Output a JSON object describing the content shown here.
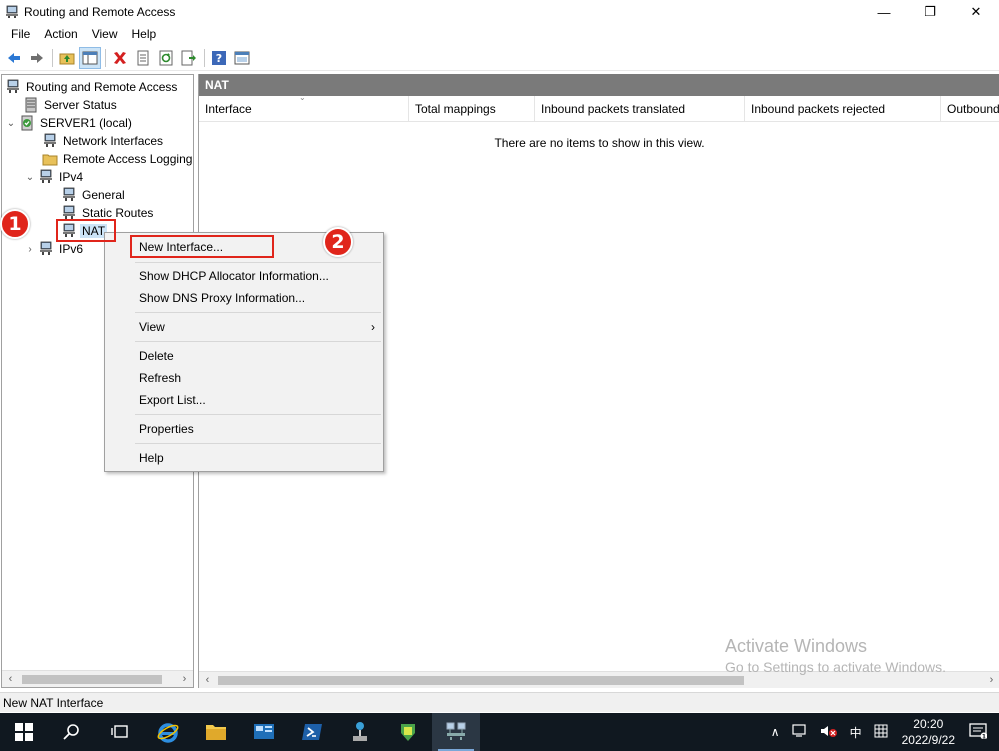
{
  "window": {
    "title": "Routing and Remote Access",
    "minimize_glyph": "—",
    "maximize_glyph": "❐",
    "close_glyph": "✕"
  },
  "menu": [
    "File",
    "Action",
    "View",
    "Help"
  ],
  "tree": {
    "root": "Routing and Remote Access",
    "server_status": "Server Status",
    "server": "SERVER1 (local)",
    "network_interfaces": "Network Interfaces",
    "remote_access_logging": "Remote Access Logging",
    "ipv4": "IPv4",
    "general": "General",
    "static_routes": "Static Routes",
    "nat": "NAT",
    "ipv6": "IPv6"
  },
  "result": {
    "header": "NAT",
    "columns": [
      "Interface",
      "Total mappings",
      "Inbound packets translated",
      "Inbound packets rejected",
      "Outbound"
    ],
    "empty_message": "There are no items to show in this view."
  },
  "context_menu": {
    "new_interface": "New Interface...",
    "show_dhcp": "Show DHCP Allocator Information...",
    "show_dns": "Show DNS Proxy Information...",
    "view": "View",
    "delete": "Delete",
    "refresh": "Refresh",
    "export_list": "Export List...",
    "properties": "Properties",
    "help": "Help"
  },
  "annotations": {
    "step1": "1",
    "step2": "2"
  },
  "watermark": {
    "line1": "Activate Windows",
    "line2": "Go to Settings to activate Windows."
  },
  "status": "New NAT Interface",
  "taskbar": {
    "tray_ime": "中",
    "time": "20:20",
    "date": "2022/9/22"
  },
  "colors": {
    "annotation_red": "#e0251b",
    "header_gray": "#7a7a7a",
    "taskbar_bg": "#101820"
  }
}
